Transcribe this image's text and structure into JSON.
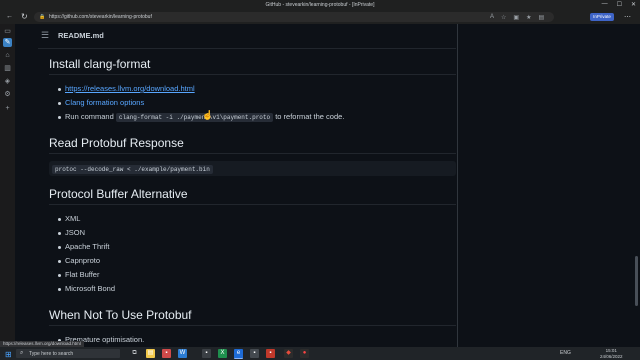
{
  "window": {
    "title": "GitHub - stevearkin/learning-protobuf - [InPrivate]",
    "controls": [
      "—",
      "☐",
      "✕"
    ]
  },
  "browser": {
    "back_icon": "back-arrow-icon",
    "reload_icon": "reload-icon",
    "url": "https://github.com/stevearkin/learning-protobuf",
    "inprivate_label": "InPrivate",
    "menu_icon": "more-icon"
  },
  "sidebar": {
    "icons": [
      "tab-actions-icon",
      "favorites-icon",
      "home-icon",
      "collections-icon",
      "shopping-icon",
      "tools-icon",
      "add-icon"
    ]
  },
  "readme": {
    "filename": "README.md",
    "sections": {
      "install": {
        "heading": "Install clang-format",
        "link1": "https://releases.llvm.org/download.html",
        "link2": "Clang formation options",
        "run_prefix": "Run command",
        "run_code": "clang-format -i ./payment\\v1\\payment.proto",
        "run_suffix": "to reformat the code."
      },
      "read": {
        "heading": "Read Protobuf Response",
        "code": "protoc --decode_raw < ./example/payment.bin"
      },
      "alternative": {
        "heading": "Protocol Buffer Alternative",
        "items": [
          "XML",
          "JSON",
          "Apache Thrift",
          "Capnproto",
          "Flat Buffer",
          "Microsoft Bond"
        ]
      },
      "when_not": {
        "heading": "When Not To Use Protobuf",
        "first_item": "Premature optimisation."
      }
    }
  },
  "statusbar": {
    "url": "https://releases.llvm.org/download.html"
  },
  "taskbar": {
    "search_placeholder": "Type here to search",
    "language": "ENG",
    "time": "15:01",
    "date": "24/06/2022"
  },
  "colors": {
    "page_bg": "#0d1117",
    "link": "#58a6ff",
    "inprivate": "#3e64c7"
  }
}
